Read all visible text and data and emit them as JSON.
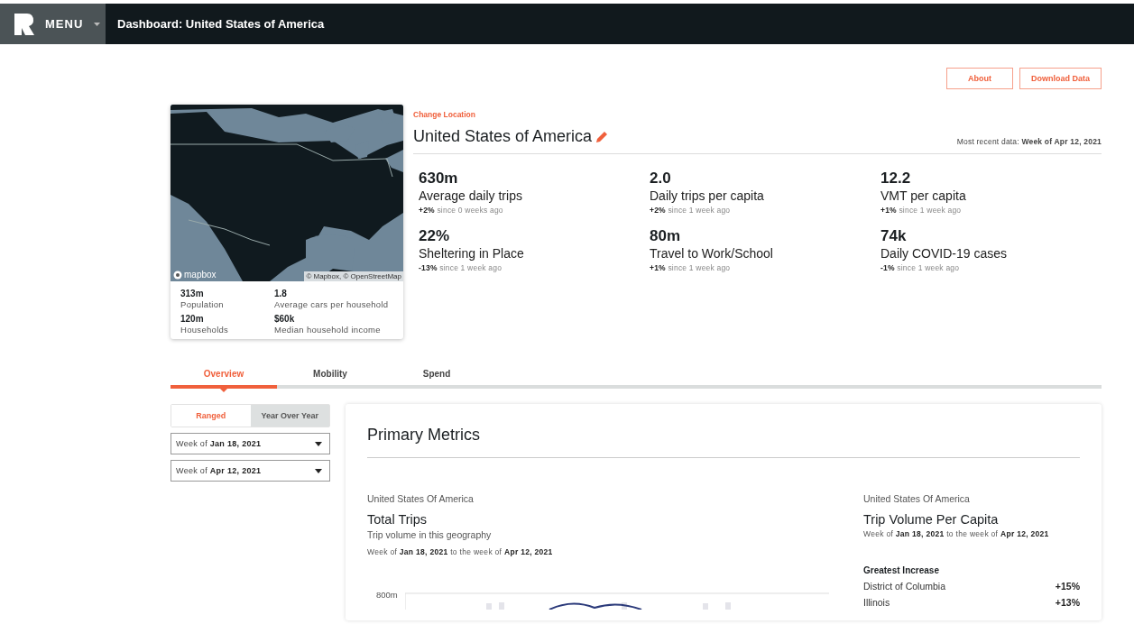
{
  "header": {
    "menu_label": "MENU",
    "title": "Dashboard: United States of America"
  },
  "actions": [
    "About",
    "Download Data"
  ],
  "location": {
    "change_label": "Change Location",
    "name": "United States of America",
    "recent": "Most recent data: **Week of Apr 12, 2021**"
  },
  "map": {
    "logo": "mapbox",
    "attribution": "© Mapbox, © OpenStreetMap"
  },
  "facts": [
    {
      "value": "313m",
      "label": "Population"
    },
    {
      "value": "1.8",
      "label": "Average cars per household"
    },
    {
      "value": "120m",
      "label": "Households"
    },
    {
      "value": "$60k",
      "label": "Median household income"
    }
  ],
  "stats": [
    {
      "value": "630m",
      "label": "Average daily trips",
      "change": "**+2%** since 0 weeks ago"
    },
    {
      "value": "2.0",
      "label": "Daily trips per capita",
      "change": "**+2%** since 1 week ago"
    },
    {
      "value": "12.2",
      "label": "VMT per capita",
      "change": "**+1%** since 1 week ago"
    },
    {
      "value": "22%",
      "label": "Sheltering in Place",
      "change": "**-13%** since 1 week ago"
    },
    {
      "value": "80m",
      "label": "Travel to Work/School",
      "change": "**+1%** since 1 week ago"
    },
    {
      "value": "74k",
      "label": "Daily COVID-19 cases",
      "change": "**-1%** since 1 week ago"
    }
  ],
  "tabs": [
    {
      "label": "Overview",
      "selected": true
    },
    {
      "label": "Mobility",
      "selected": false
    },
    {
      "label": "Spend",
      "selected": false
    }
  ],
  "mode": [
    {
      "label": "Ranged",
      "selected": true
    },
    {
      "label": "Year Over Year",
      "selected": false
    }
  ],
  "date_selects": [
    "Week of **Jan 18, 2021**",
    "Week of **Apr 12, 2021**"
  ],
  "panel": {
    "title": "Primary Metrics",
    "left": {
      "place": "United States Of America",
      "title": "Total Trips",
      "subtitle": "Trip volume in this geography",
      "range": "Week of **Jan 18, 2021** to the week of **Apr 12, 2021**",
      "axis_label": "800m"
    },
    "right": {
      "place": "United States Of America",
      "title": "Trip Volume Per Capita",
      "range": "Week of **Jan 18, 2021** to the week of **Apr 12, 2021**",
      "list_title": "Greatest Increase",
      "rows": [
        {
          "name": "District of Columbia",
          "value": "+15%"
        },
        {
          "name": "Illinois",
          "value": "+13%"
        }
      ]
    }
  }
}
